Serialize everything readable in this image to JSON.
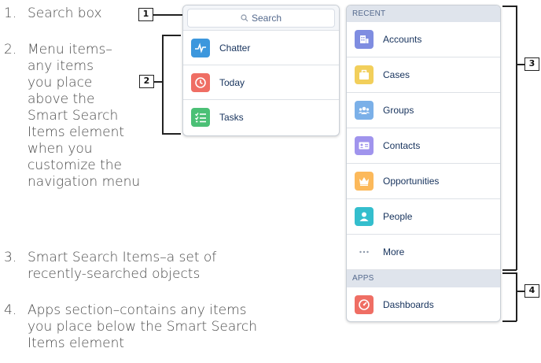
{
  "legend": {
    "items": [
      {
        "number": "1.",
        "text": [
          "Search box"
        ]
      },
      {
        "number": "2.",
        "text": [
          "Menu items–",
          "any items",
          "you place",
          "above the",
          "Smart Search",
          "Items element",
          "when you",
          "customize the",
          "navigation menu"
        ]
      },
      {
        "number": "3.",
        "text": [
          "Smart Search Items–a set of",
          "recently-searched objects"
        ]
      },
      {
        "number": "4.",
        "text": [
          "Apps section–contains any items",
          "you place below the Smart Search",
          "Items element"
        ]
      }
    ]
  },
  "callouts": [
    "1",
    "2",
    "3",
    "4"
  ],
  "menu_panel": {
    "search_placeholder": "Search",
    "items": [
      {
        "label": "Chatter",
        "icon": "chatter-icon",
        "color": "#3c97dd"
      },
      {
        "label": "Today",
        "icon": "clock-icon",
        "color": "#ef6e64"
      },
      {
        "label": "Tasks",
        "icon": "tasks-icon",
        "color": "#4bc076"
      }
    ]
  },
  "smart_panel": {
    "recent_header": "RECENT",
    "recent_items": [
      {
        "label": "Accounts",
        "icon": "accounts-icon",
        "color": "#7f8de1"
      },
      {
        "label": "Cases",
        "icon": "cases-icon",
        "color": "#f2cf5b"
      },
      {
        "label": "Groups",
        "icon": "groups-icon",
        "color": "#7bb0e8"
      },
      {
        "label": "Contacts",
        "icon": "contacts-icon",
        "color": "#a094ed"
      },
      {
        "label": "Opportunities",
        "icon": "crown-icon",
        "color": "#fcb95b"
      },
      {
        "label": "People",
        "icon": "person-icon",
        "color": "#34becd"
      },
      {
        "label": "More",
        "icon": "more-icon",
        "color": "#ffffff"
      }
    ],
    "apps_header": "APPS",
    "app_items": [
      {
        "label": "Dashboards",
        "icon": "dashboard-icon",
        "color": "#ef6e64"
      }
    ]
  }
}
